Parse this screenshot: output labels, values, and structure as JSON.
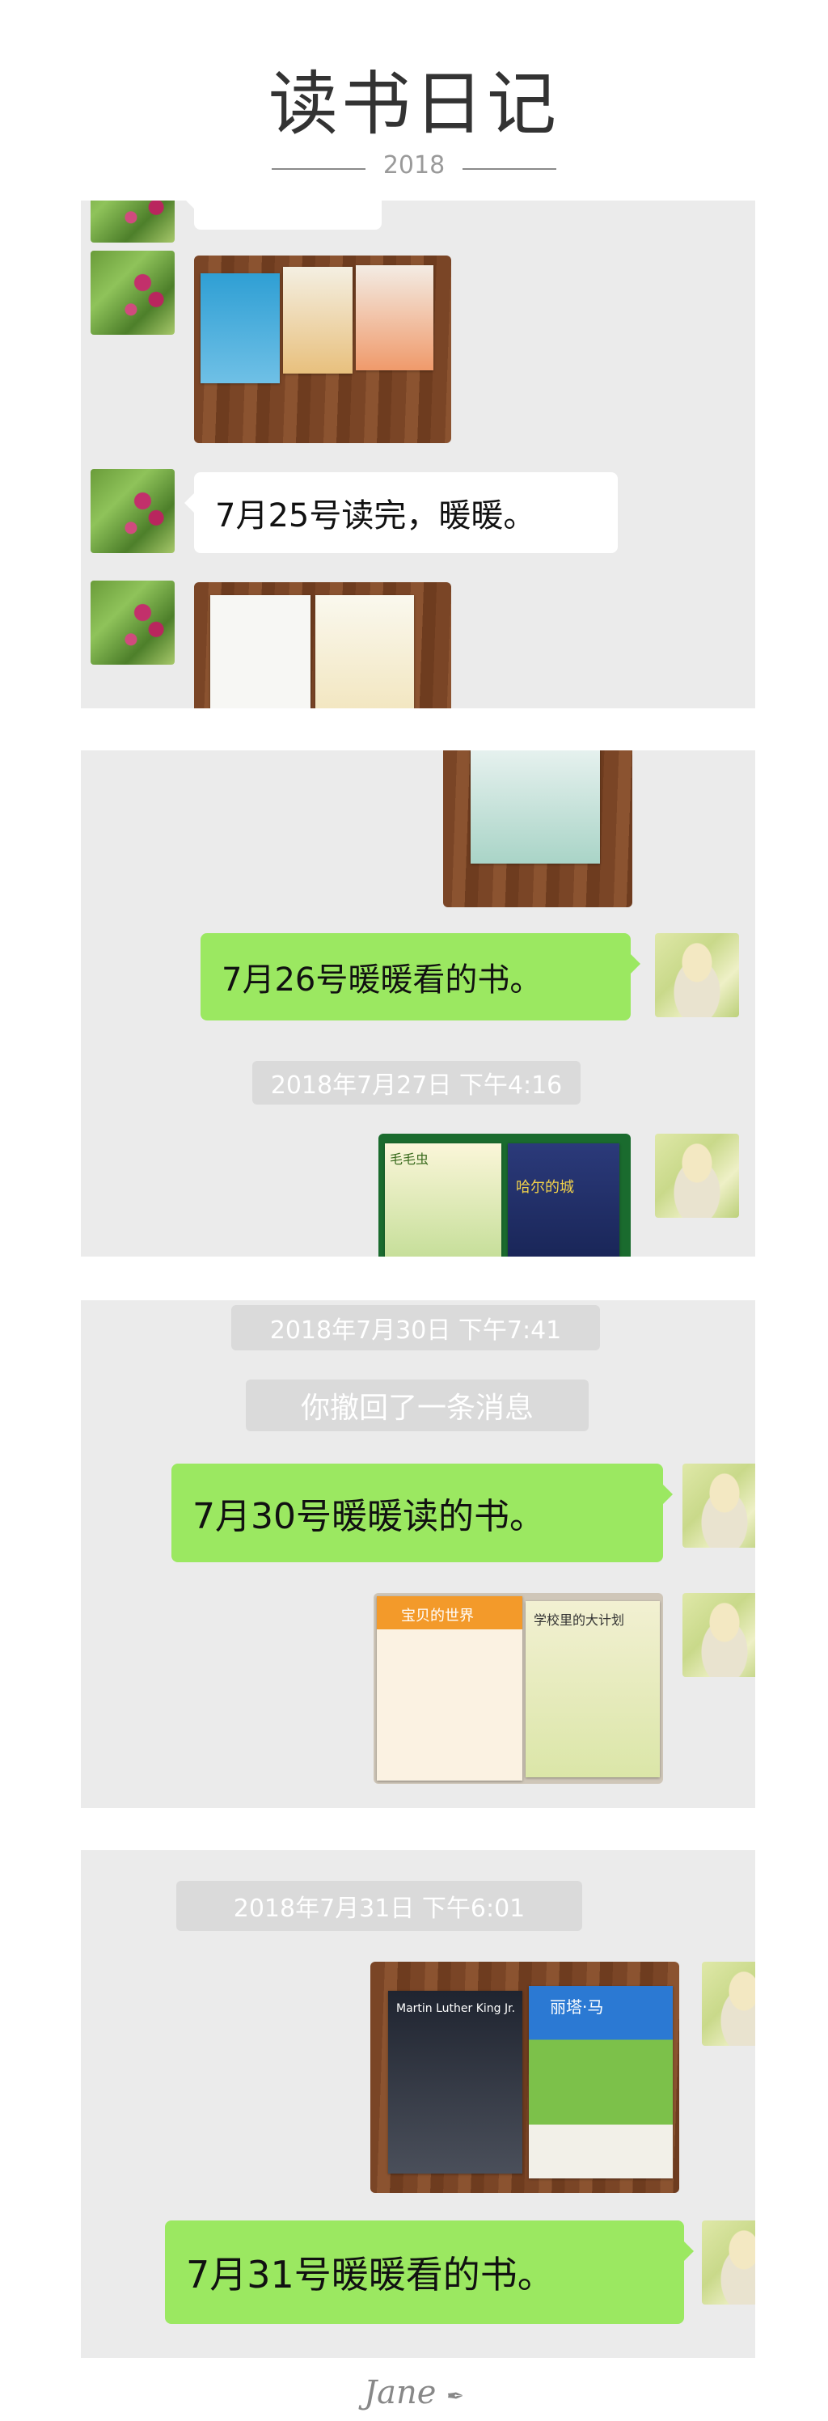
{
  "header": {
    "title": "读书日记",
    "year": "2018"
  },
  "messages": {
    "m1": "7月25号读完，暖暖。",
    "m2": "7月26号暖暖看的书。",
    "m3": "7月30号暖暖读的书。",
    "m4": "7月31号暖暖看的书。"
  },
  "timestamps": {
    "t1": "2018年7月27日 下午4:16",
    "t2": "2018年7月30日 下午7:41",
    "t3": "2018年7月31日 下午6:01"
  },
  "system": {
    "recalled": "你撤回了一条消息"
  },
  "book_covers": {
    "b1": "Martin Luther King Jr.",
    "b2": "丽塔·马",
    "b3": "毛毛虫",
    "b4": "哈尔的城",
    "b5": "宝贝的世界",
    "b6": "学校里的大计划"
  },
  "footer": {
    "signature": "Jane"
  }
}
